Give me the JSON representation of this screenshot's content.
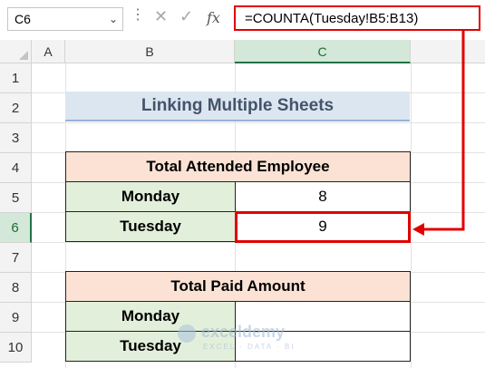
{
  "formula_bar": {
    "name_box": "C6",
    "cancel_icon": "✕",
    "enter_icon": "✓",
    "fx_label": "fx",
    "formula": "=COUNTA(Tuesday!B5:B13)"
  },
  "columns": [
    "A",
    "B",
    "C"
  ],
  "rows": [
    "1",
    "2",
    "3",
    "4",
    "5",
    "6",
    "7",
    "8",
    "9",
    "10"
  ],
  "sheet": {
    "title": "Linking Multiple Sheets",
    "table1": {
      "header": "Total Attended Employee",
      "rows": [
        {
          "label": "Monday",
          "value": "8"
        },
        {
          "label": "Tuesday",
          "value": "9"
        }
      ]
    },
    "table2": {
      "header": "Total Paid Amount",
      "rows": [
        {
          "label": "Monday",
          "value": ""
        },
        {
          "label": "Tuesday",
          "value": ""
        }
      ]
    }
  },
  "watermark": {
    "brand": "exceldemy",
    "tagline": "EXCEL · DATA · BI"
  },
  "colors": {
    "highlight_red": "#e00000",
    "title_fill": "#dce6f1",
    "header_fill": "#fbe2d5",
    "label_fill": "#e2efda",
    "active_header": "#d3e8d8"
  }
}
